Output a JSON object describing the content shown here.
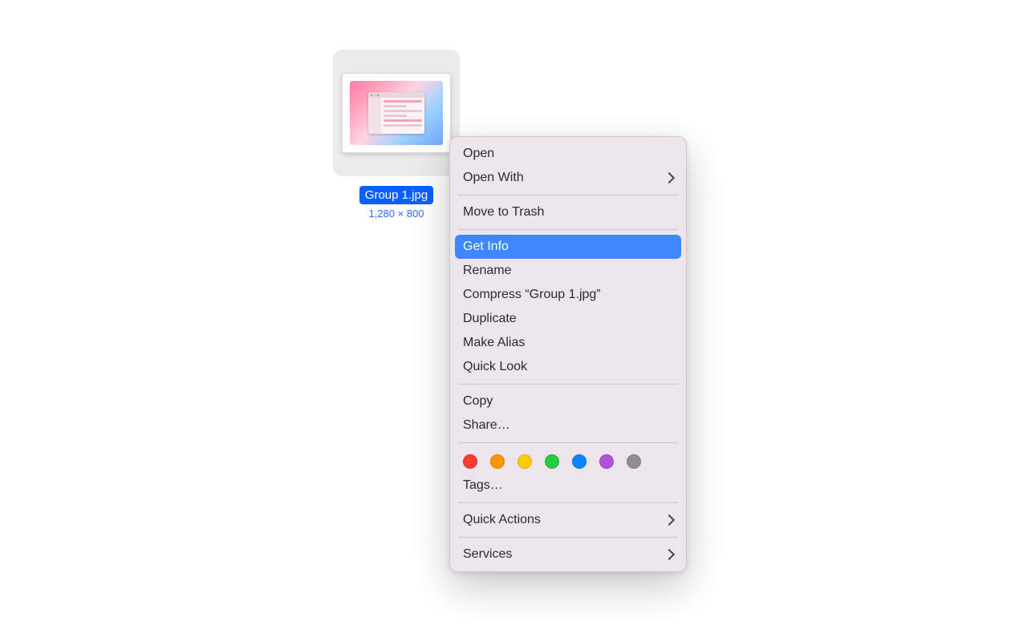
{
  "file": {
    "name": "Group 1.jpg",
    "dimensions": "1,280 × 800"
  },
  "context_menu": {
    "highlighted": "get_info",
    "items": {
      "open": "Open",
      "open_with": "Open With",
      "move_to_trash": "Move to Trash",
      "get_info": "Get Info",
      "rename": "Rename",
      "compress": "Compress “Group 1.jpg”",
      "duplicate": "Duplicate",
      "make_alias": "Make Alias",
      "quick_look": "Quick Look",
      "copy": "Copy",
      "share": "Share…",
      "tags": "Tags…",
      "quick_actions": "Quick Actions",
      "services": "Services"
    },
    "tag_colors": [
      "red",
      "orange",
      "yellow",
      "green",
      "blue",
      "purple",
      "gray"
    ]
  }
}
